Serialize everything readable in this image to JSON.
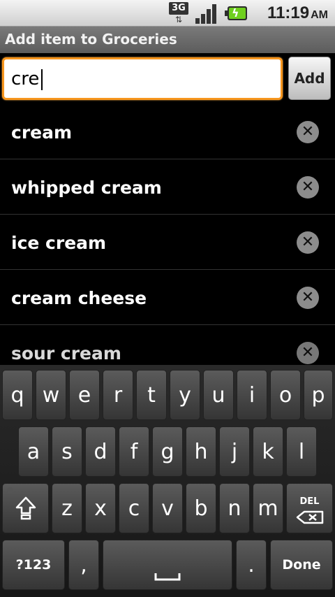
{
  "status_bar": {
    "network_label": "3G",
    "time": "11:19",
    "ampm": "AM"
  },
  "title_bar": {
    "title": "Add item to Groceries"
  },
  "input": {
    "value": "cre",
    "add_label": "Add"
  },
  "suggestions": [
    {
      "label": "cream"
    },
    {
      "label": "whipped cream"
    },
    {
      "label": "ice cream"
    },
    {
      "label": "cream cheese"
    },
    {
      "label": "sour cream"
    }
  ],
  "keyboard": {
    "row1": [
      "q",
      "w",
      "e",
      "r",
      "t",
      "y",
      "u",
      "i",
      "o",
      "p"
    ],
    "row2": [
      "a",
      "s",
      "d",
      "f",
      "g",
      "h",
      "j",
      "k",
      "l"
    ],
    "row3": [
      "z",
      "x",
      "c",
      "v",
      "b",
      "n",
      "m"
    ],
    "del_label": "DEL",
    "symbols_label": "?123",
    "comma": ",",
    "period": ".",
    "done_label": "Done"
  }
}
